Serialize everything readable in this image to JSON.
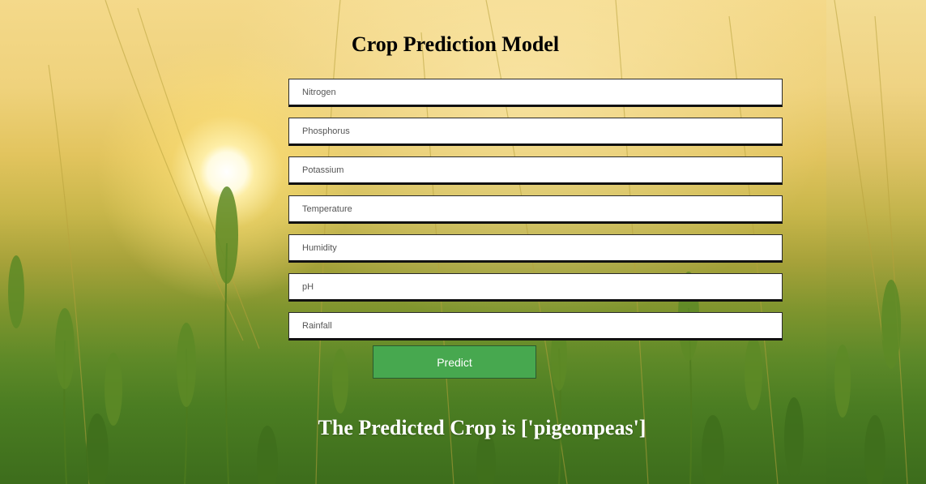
{
  "page": {
    "title": "Crop Prediction Model"
  },
  "form": {
    "fields": [
      {
        "name": "nitrogen",
        "placeholder": "Nitrogen",
        "value": ""
      },
      {
        "name": "phosphorus",
        "placeholder": "Phosphorus",
        "value": ""
      },
      {
        "name": "potassium",
        "placeholder": "Potassium",
        "value": ""
      },
      {
        "name": "temperature",
        "placeholder": "Temperature",
        "value": ""
      },
      {
        "name": "humidity",
        "placeholder": "Humidity",
        "value": ""
      },
      {
        "name": "ph",
        "placeholder": "pH",
        "value": ""
      },
      {
        "name": "rainfall",
        "placeholder": "Rainfall",
        "value": ""
      }
    ],
    "submit_label": "Predict"
  },
  "result": {
    "text": "The Predicted Crop is ['pigeonpeas']"
  },
  "colors": {
    "button_bg": "#47a84f",
    "button_text": "#ffffff",
    "result_text": "#ffffff",
    "title_text": "#000000"
  },
  "background": {
    "image": "wheat-field-sunset"
  }
}
